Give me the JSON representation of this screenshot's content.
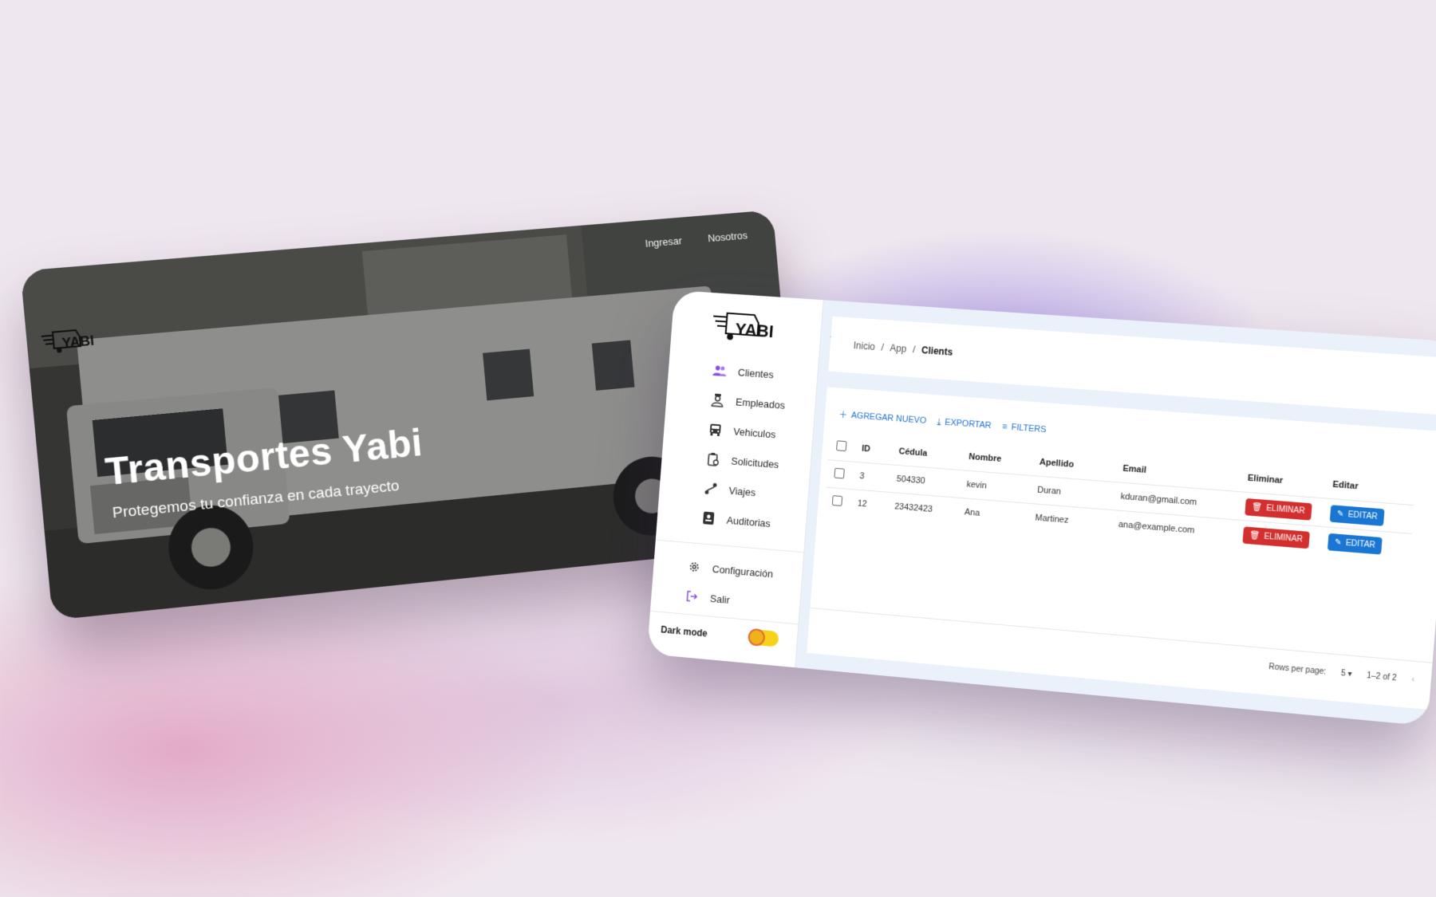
{
  "landing": {
    "nav": [
      "Ingresar",
      "Nosotros"
    ],
    "logo_text": "YABI",
    "hero_title": "Transportes Yabi",
    "hero_subtitle": "Protegemos tu confianza en cada trayecto"
  },
  "dashboard": {
    "logo_text": "YABI",
    "sidebar": {
      "items": [
        {
          "label": "Clientes",
          "icon": "users-icon"
        },
        {
          "label": "Empleados",
          "icon": "employee-icon"
        },
        {
          "label": "Vehiculos",
          "icon": "bus-icon"
        },
        {
          "label": "Solicitudes",
          "icon": "clipboard-icon"
        },
        {
          "label": "Viajes",
          "icon": "route-icon"
        },
        {
          "label": "Auditorias",
          "icon": "badge-icon"
        }
      ],
      "bottom_items": [
        {
          "label": "Configuración",
          "icon": "gear-icon"
        },
        {
          "label": "Salir",
          "icon": "logout-icon"
        }
      ],
      "dark_mode_label": "Dark mode"
    },
    "breadcrumb": [
      "Inicio",
      "App",
      "Clients"
    ],
    "toolbar": {
      "add_label": "AGREGAR NUEVO",
      "export_label": "EXPORTAR",
      "filters_label": "FILTERS"
    },
    "table": {
      "columns": [
        "ID",
        "Cédula",
        "Nombre",
        "Apellido",
        "Email",
        "Eliminar",
        "Editar"
      ],
      "rows": [
        {
          "id": "3",
          "cedula": "504330",
          "nombre": "kevin",
          "apellido": "Duran",
          "email": "kduran@gmail.com"
        },
        {
          "id": "12",
          "cedula": "23432423",
          "nombre": "Ana",
          "apellido": "Martinez",
          "email": "ana@example.com"
        }
      ],
      "delete_label": "ELIMINAR",
      "edit_label": "EDITAR"
    },
    "pagination": {
      "rows_per_page_label": "Rows per page:",
      "rows_per_page_value": "5",
      "range": "1–2 of 2"
    },
    "colors": {
      "accent_purple": "#8a4fe0",
      "primary_blue": "#1976d2",
      "danger_red": "#d32f2f",
      "toggle_yellow": "#f6d31a"
    }
  }
}
